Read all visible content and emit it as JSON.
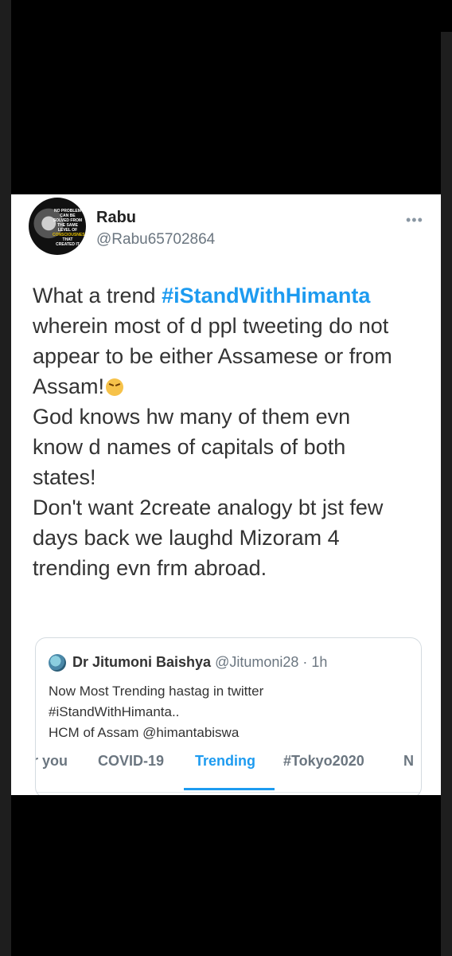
{
  "tweet": {
    "author_name": "Rabu",
    "author_handle": "@Rabu65702864",
    "avatar_quote": "NO PROBLEM CAN BE SOLVED FROM THE SAME LEVEL OF CONSCIOUSNESS THAT CREATED IT",
    "body_lines": [
      {
        "before": "What a trend ",
        "hashtag": "#iStandWithHimanta"
      },
      {
        "text": "wherein most of d ppl tweeting do not"
      },
      {
        "text": "appear to be either Assamese or from"
      },
      {
        "text": "Assam!"
      },
      {
        "text": "God knows hw many of them evn"
      },
      {
        "text": "know d names of capitals of both"
      },
      {
        "text": "states!"
      },
      {
        "text": "Don't want 2create analogy bt jst few"
      },
      {
        "text": "days back we laughd Mizoram 4"
      },
      {
        "text": "trending evn frm abroad."
      }
    ]
  },
  "quoted_tweet": {
    "author_name": "Dr Jitumoni Baishya",
    "meta": "@Jitumoni28 · 1h",
    "lines": [
      "Now Most Trending hastag in twitter",
      "#iStandWithHimanta..",
      "HCM of Assam @himantabiswa"
    ]
  },
  "tabs": [
    {
      "label": "r you",
      "active": false
    },
    {
      "label": "COVID-19",
      "active": false
    },
    {
      "label": "Trending",
      "active": true
    },
    {
      "label": "#Tokyo2020",
      "active": false
    },
    {
      "label": "N",
      "active": false
    }
  ],
  "colors": {
    "accent": "#1d9bf0",
    "text": "#333333",
    "muted": "#6b7680",
    "background": "#000000"
  },
  "icons": {
    "more": "more-horizontal-icon",
    "emoji": "persevering-face-emoji"
  }
}
